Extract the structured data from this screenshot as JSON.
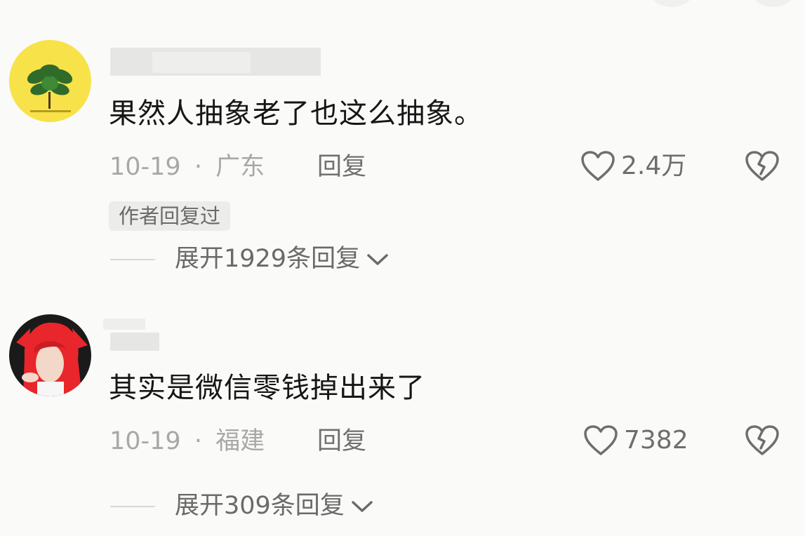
{
  "comments": [
    {
      "text": "果然人抽象老了也这么抽象。",
      "date": "10-19",
      "separator": "·",
      "location": "广东",
      "reply_label": "回复",
      "likes": "2.4万",
      "tag": "作者回复过",
      "expand_label": "展开1929条回复"
    },
    {
      "text": "其实是微信零钱掉出来了",
      "date": "10-19",
      "separator": "·",
      "location": "福建",
      "reply_label": "回复",
      "likes": "7382",
      "expand_label": "展开309条回复"
    }
  ],
  "icons": {
    "like": "heart-outline-icon",
    "dislike": "broken-heart-icon",
    "expand": "chevron-down-icon"
  },
  "colors": {
    "background": "#fafaf8",
    "text": "#161616",
    "meta": "#a8a8a8",
    "avatar1_bg": "#f7e24a",
    "avatar2_hair": "#e8262b"
  }
}
